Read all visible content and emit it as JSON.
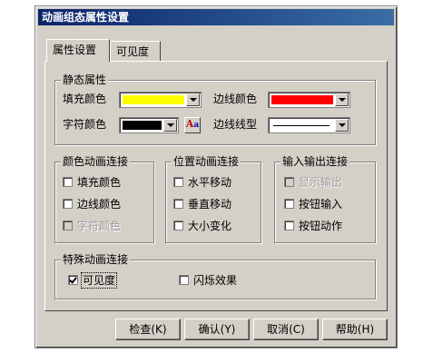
{
  "window": {
    "title": "动画组态属性设置"
  },
  "tabs": [
    {
      "label": "属性设置",
      "active": true
    },
    {
      "label": "可见度",
      "active": false
    }
  ],
  "static_props": {
    "title": "静态属性",
    "fill_color_label": "填充颜色",
    "fill_color_value": "#ffff00",
    "border_color_label": "边线颜色",
    "border_color_value": "#ff0000",
    "char_color_label": "字符颜色",
    "char_color_value": "#000000",
    "border_style_label": "边线线型",
    "font_button_text": "Aa"
  },
  "color_anim": {
    "title": "颜色动画连接",
    "items": [
      {
        "label": "填充颜色",
        "checked": false,
        "disabled": false
      },
      {
        "label": "边线颜色",
        "checked": false,
        "disabled": false
      },
      {
        "label": "字符颜色",
        "checked": false,
        "disabled": true
      }
    ]
  },
  "position_anim": {
    "title": "位置动画连接",
    "items": [
      {
        "label": "水平移动",
        "checked": false,
        "disabled": false
      },
      {
        "label": "垂直移动",
        "checked": false,
        "disabled": false
      },
      {
        "label": "大小变化",
        "checked": false,
        "disabled": false
      }
    ]
  },
  "io_link": {
    "title": "输入输出连接",
    "items": [
      {
        "label": "显示输出",
        "checked": false,
        "disabled": true
      },
      {
        "label": "按钮输入",
        "checked": false,
        "disabled": false
      },
      {
        "label": "按钮动作",
        "checked": false,
        "disabled": false
      }
    ]
  },
  "special_anim": {
    "title": "特殊动画连接",
    "items": [
      {
        "label": "可见度",
        "checked": true,
        "disabled": false
      },
      {
        "label": "闪烁效果",
        "checked": false,
        "disabled": false
      }
    ]
  },
  "buttons": {
    "check": "检查(K)",
    "ok": "确认(Y)",
    "cancel": "取消(C)",
    "help": "帮助(H)"
  }
}
